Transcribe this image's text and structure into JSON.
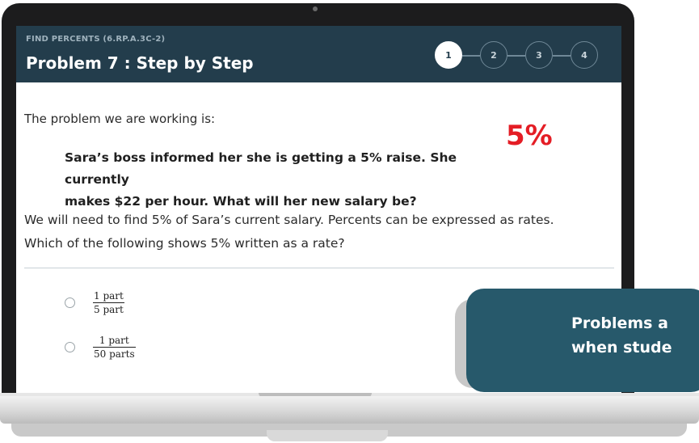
{
  "header": {
    "standard_code": "FIND PERCENTS (6.RP.A.3C-2)",
    "title": "Problem 7 : Step by Step",
    "steps": [
      "1",
      "2",
      "3",
      "4"
    ],
    "active_step": "1"
  },
  "content": {
    "prompt": "The problem we are working is:",
    "highlight_percent": "5%",
    "problem_line_1": "Sara’s boss informed her she is getting a 5% raise. She currently",
    "problem_line_2": "makes $22 per hour. What will her new salary be?",
    "explanation_line_1": "We will need to find 5% of Sara’s current salary. Percents can be expressed as rates.",
    "explanation_line_2": "Which of the following shows 5% written as a rate?"
  },
  "options": [
    {
      "numerator": "1 part",
      "denominator": "5 part"
    },
    {
      "numerator": "1 part",
      "denominator": "50 parts"
    }
  ],
  "callout": {
    "line_1": "Problems a",
    "line_2": "when stude"
  },
  "colors": {
    "header_bg": "#233d4c",
    "percent_red": "#e41d25",
    "callout_bg": "#27596b"
  }
}
